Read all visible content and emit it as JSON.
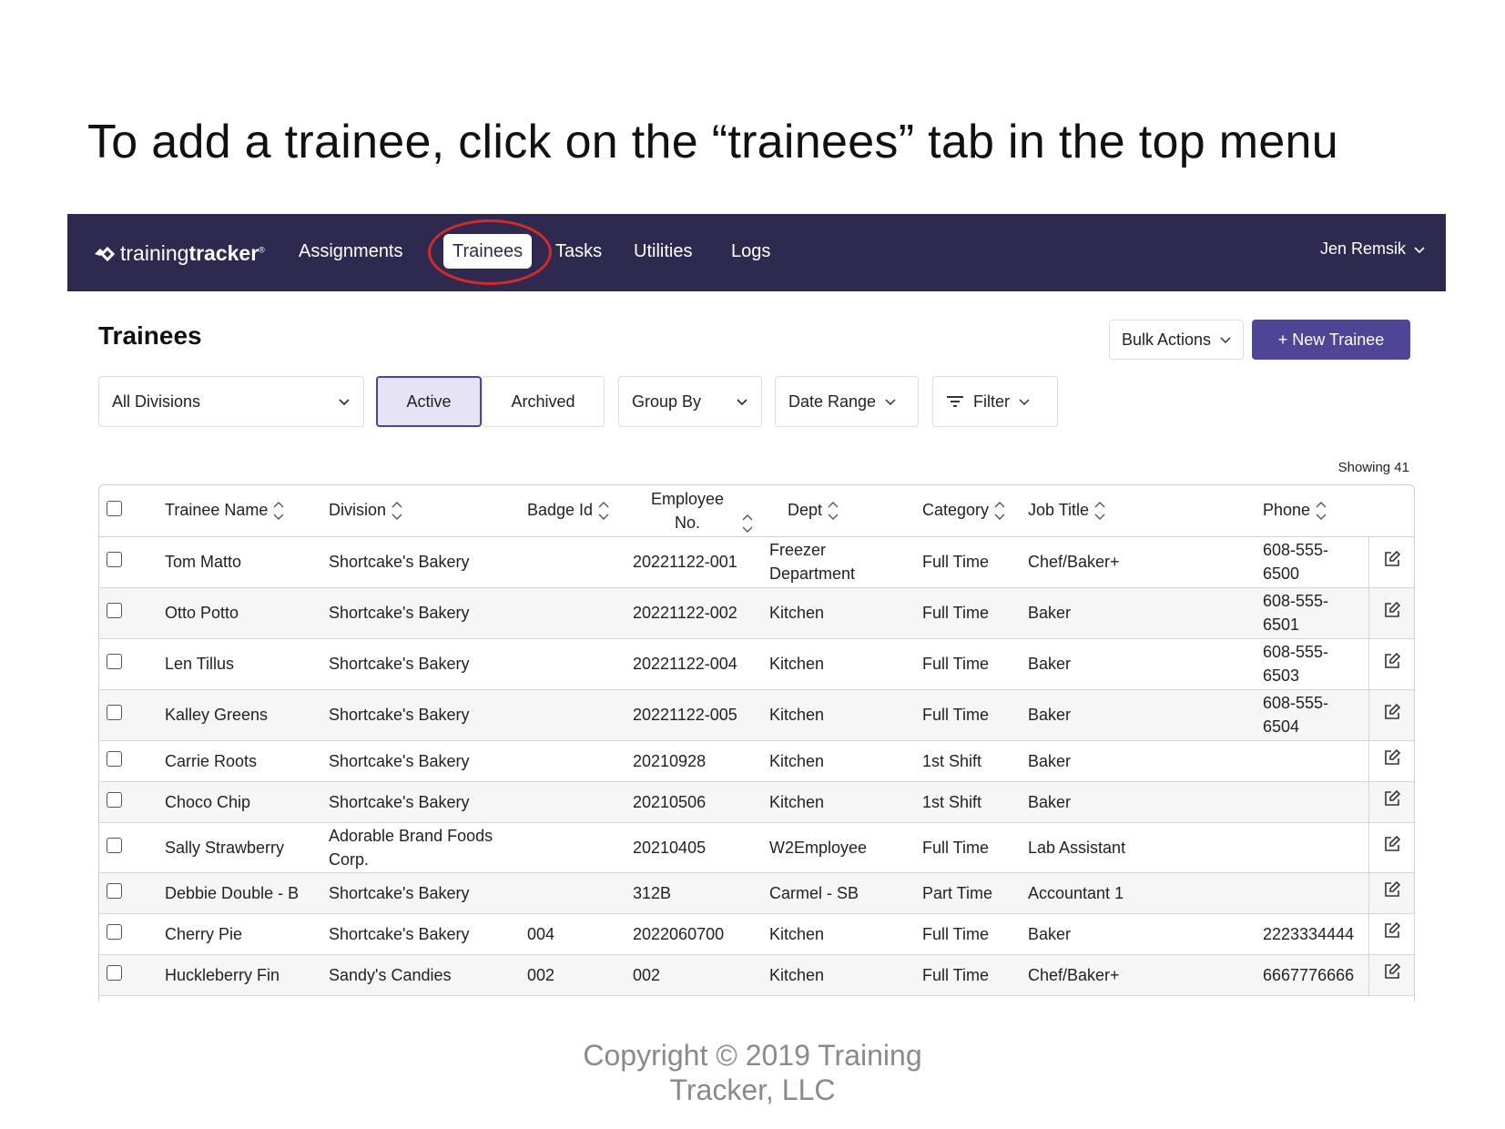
{
  "slide": {
    "instruction": "To add a trainee, click on the “trainees” tab in the top menu",
    "copyright_line1": "Copyright © 2019 Training",
    "copyright_line2": "Tracker, LLC"
  },
  "navbar": {
    "logo_light": "training",
    "logo_bold": "tracker",
    "logo_mark": "®",
    "items": [
      {
        "label": "Assignments"
      },
      {
        "label": "Trainees",
        "active": true
      },
      {
        "label": "Tasks"
      },
      {
        "label": "Utilities"
      },
      {
        "label": "Logs"
      }
    ],
    "user": "Jen Remsik",
    "highlight_color": "#d62a24",
    "bg_color": "#2e2a4f"
  },
  "page": {
    "title": "Trainees",
    "bulk_actions": "Bulk Actions",
    "new_trainee": "+ New Trainee",
    "primary_color": "#4f4597"
  },
  "filters": {
    "division": "All Divisions",
    "active": "Active",
    "archived": "Archived",
    "group_by": "Group By",
    "date_range": "Date Range",
    "filter": "Filter",
    "showing": "Showing 41"
  },
  "table": {
    "columns": {
      "name": "Trainee Name",
      "division": "Division",
      "badge": "Badge Id",
      "employee_1": "Employee",
      "employee_2": "No.",
      "dept": "Dept",
      "category": "Category",
      "job": "Job Title",
      "phone": "Phone"
    },
    "rows": [
      {
        "name": "Tom Matto",
        "division": "Shortcake's Bakery",
        "badge": "",
        "employee": "20221122-001",
        "dept": "Freezer Department",
        "category": "Full Time",
        "job": "Chef/Baker+",
        "phone": "608-555-6500"
      },
      {
        "name": "Otto Potto",
        "division": "Shortcake's Bakery",
        "badge": "",
        "employee": "20221122-002",
        "dept": "Kitchen",
        "category": "Full Time",
        "job": "Baker",
        "phone": "608-555-6501"
      },
      {
        "name": "Len Tillus",
        "division": "Shortcake's Bakery",
        "badge": "",
        "employee": "20221122-004",
        "dept": "Kitchen",
        "category": "Full Time",
        "job": "Baker",
        "phone": "608-555-6503"
      },
      {
        "name": "Kalley Greens",
        "division": "Shortcake's Bakery",
        "badge": "",
        "employee": "20221122-005",
        "dept": "Kitchen",
        "category": "Full Time",
        "job": "Baker",
        "phone": "608-555-6504"
      },
      {
        "name": "Carrie Roots",
        "division": "Shortcake's Bakery",
        "badge": "",
        "employee": "20210928",
        "dept": "Kitchen",
        "category": "1st Shift",
        "job": "Baker",
        "phone": ""
      },
      {
        "name": "Choco Chip",
        "division": "Shortcake's Bakery",
        "badge": "",
        "employee": "20210506",
        "dept": "Kitchen",
        "category": "1st Shift",
        "job": "Baker",
        "phone": ""
      },
      {
        "name": "Sally Strawberry",
        "division": "Adorable Brand Foods Corp.",
        "badge": "",
        "employee": "20210405",
        "dept": "W2Employee",
        "category": "Full Time",
        "job": "Lab Assistant",
        "phone": ""
      },
      {
        "name": "Debbie Double - B",
        "division": "Shortcake's Bakery",
        "badge": "",
        "employee": "312B",
        "dept": "Carmel - SB",
        "category": "Part Time",
        "job": "Accountant 1",
        "phone": ""
      },
      {
        "name": "Cherry Pie",
        "division": "Shortcake's Bakery",
        "badge": "004",
        "employee": "2022060700",
        "dept": "Kitchen",
        "category": "Full Time",
        "job": "Baker",
        "phone": "2223334444"
      },
      {
        "name": "Huckleberry Fin",
        "division": "Sandy's Candies",
        "badge": "002",
        "employee": "002",
        "dept": "Kitchen",
        "category": "Full Time",
        "job": "Chef/Baker+",
        "phone": "6667776666"
      }
    ]
  }
}
